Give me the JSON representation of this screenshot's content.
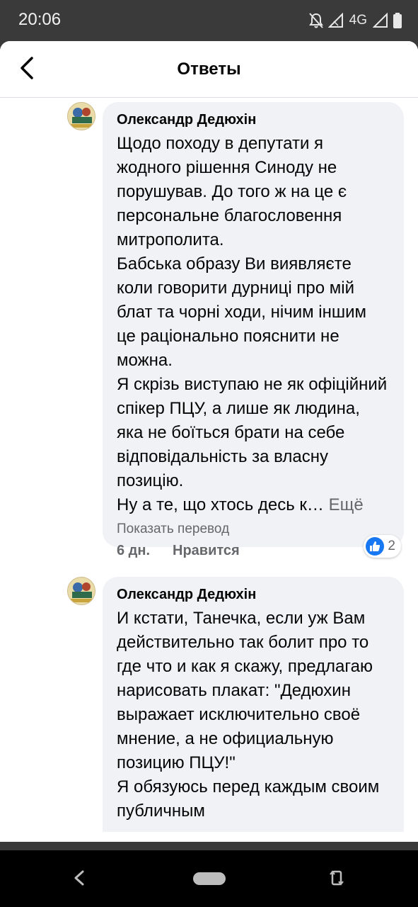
{
  "status_bar": {
    "time": "20:06",
    "network": "4G",
    "icons": [
      "bell-off-icon",
      "signal-icon",
      "signal-icon",
      "battery-icon"
    ]
  },
  "header": {
    "title": "Ответы",
    "back_icon": "chevron-left-icon"
  },
  "comments": [
    {
      "author": "Олександр Дедюхін",
      "text": "Щодо походу в депутати я жодного рішення Синоду не порушував. До того ж на це є персональне благословення митрополита.\nБабська образу Ви виявляєте коли говорити дурниці про мій блат та чорні ходи, нічим іншим це раціонально пояснити не можна.\nЯ скрізь виступаю не як офіційний спікер ПЦУ,  а лише як людина,  яка не боїться брати на себе відповідальність за власну позицію.\nНу а те, що хтось десь к…",
      "more_label": "Ещё",
      "translate_label": "Показать перевод",
      "time": "6 дн.",
      "like_label": "Нравится",
      "reaction_icon": "thumbs-up-icon",
      "reaction_count": "2"
    },
    {
      "author": "Олександр Дедюхін",
      "text": "И кстати,  Танечка,  если уж Вам действительно так болит про то где что и как я скажу, предлагаю нарисовать плакат: \"Дедюхин выражает исключительно своё мнение, а не официальную позицию ПЦУ!\"\nЯ обязуюсь перед каждым своим публичным"
    }
  ],
  "nav_bar": {
    "icons": [
      "back-triangle-icon",
      "home-pill-icon",
      "rotate-icon"
    ]
  },
  "colors": {
    "bubble": "#f0f2f5",
    "like_blue": "#1877f2",
    "secondary_text": "#65676b"
  }
}
